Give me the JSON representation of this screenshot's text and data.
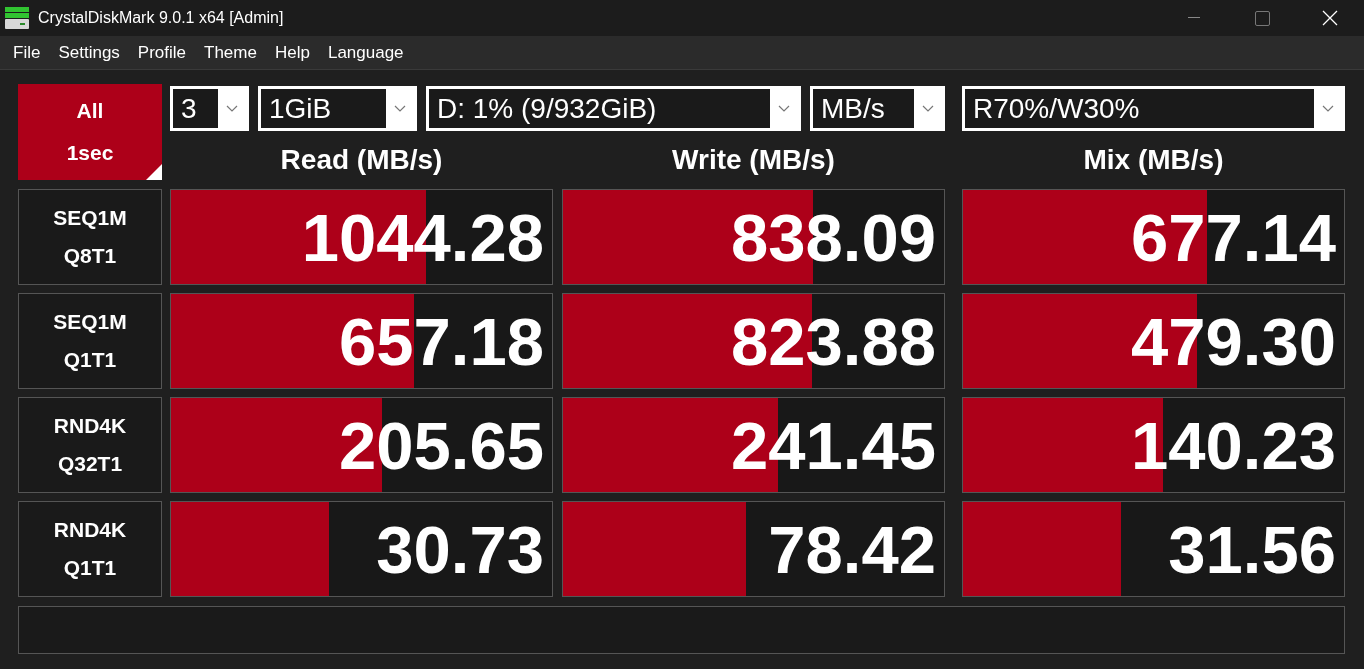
{
  "window": {
    "title": "CrystalDiskMark 9.0.1 x64 [Admin]"
  },
  "menu": [
    "File",
    "Settings",
    "Profile",
    "Theme",
    "Help",
    "Language"
  ],
  "run_button": {
    "label": "All",
    "sublabel": "1sec"
  },
  "settings": [
    "3",
    "1GiB",
    "D: 1% (9/932GiB)",
    "MB/s"
  ],
  "mix_ratio": "R70%/W30%",
  "columns": [
    "Read (MB/s)",
    "Write (MB/s)",
    "Mix (MB/s)"
  ],
  "tests": [
    {
      "name": "SEQ1M",
      "params": "Q8T1",
      "results": [
        {
          "value": "1044.28",
          "level": 0.67
        },
        {
          "value": "838.09",
          "level": 0.655
        },
        {
          "value": "677.14",
          "level": 0.64
        }
      ]
    },
    {
      "name": "SEQ1M",
      "params": "Q1T1",
      "results": [
        {
          "value": "657.18",
          "level": 0.637
        },
        {
          "value": "823.88",
          "level": 0.653
        },
        {
          "value": "479.30",
          "level": 0.614
        }
      ]
    },
    {
      "name": "RND4K",
      "params": "Q32T1",
      "results": [
        {
          "value": "205.65",
          "level": 0.553
        },
        {
          "value": "241.45",
          "level": 0.564
        },
        {
          "value": "140.23",
          "level": 0.525
        }
      ]
    },
    {
      "name": "RND4K",
      "params": "Q1T1",
      "results": [
        {
          "value": "30.73",
          "level": 0.415
        },
        {
          "value": "78.42",
          "level": 0.48
        },
        {
          "value": "31.56",
          "level": 0.415
        }
      ]
    }
  ]
}
